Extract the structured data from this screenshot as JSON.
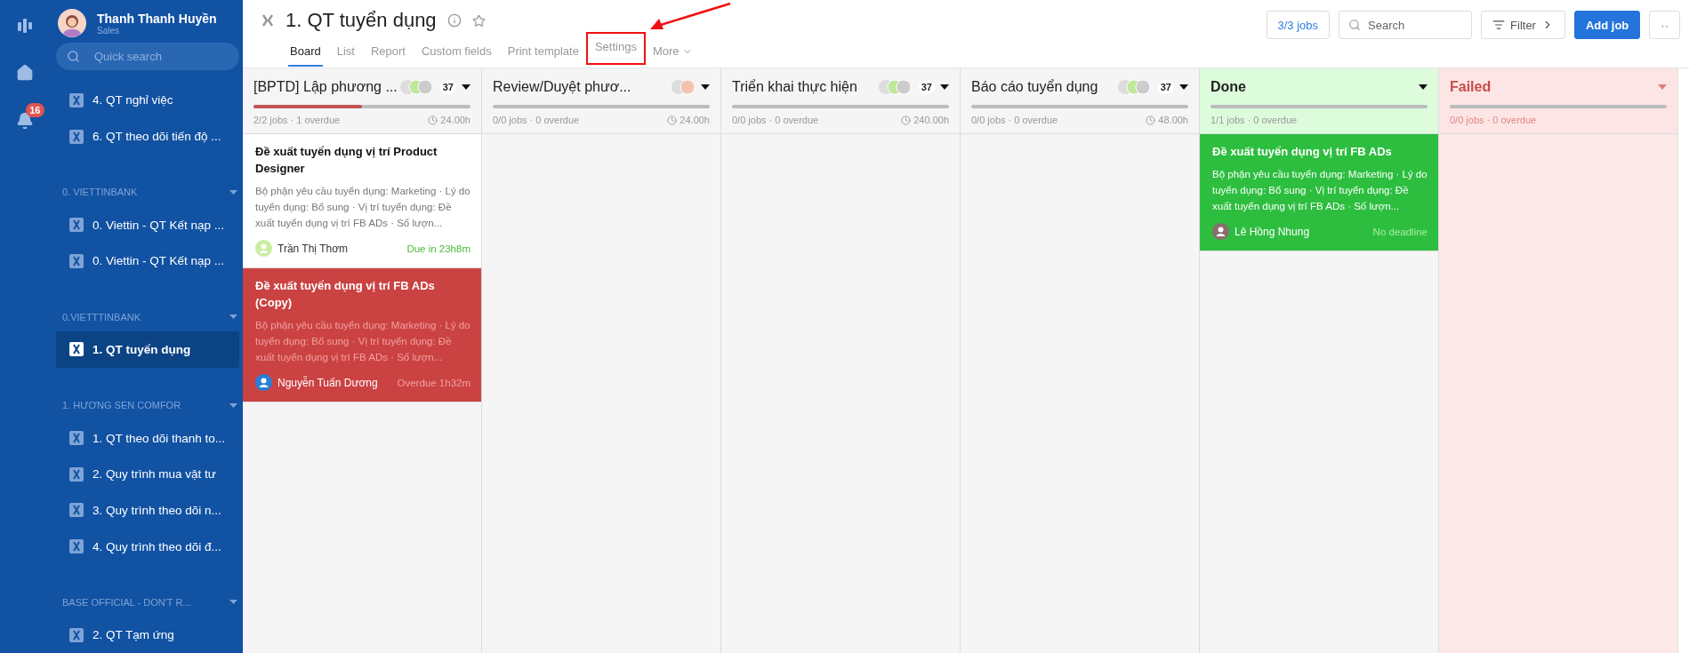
{
  "user": {
    "name": "Thanh Thanh Huyền",
    "role": "Sales"
  },
  "rail": {
    "notification_count": "16"
  },
  "search": {
    "placeholder": "Quick search"
  },
  "sidebar": [
    {
      "kind": "item",
      "label": "4. QT nghỉ việc",
      "selected": false
    },
    {
      "kind": "item",
      "label": "6. QT theo dõi tiến độ ...",
      "selected": false
    },
    {
      "kind": "group",
      "label": "0. VIETTINBANK"
    },
    {
      "kind": "item",
      "label": "0. Viettin - QT Kết nạp ...",
      "selected": false
    },
    {
      "kind": "item",
      "label": "0. Viettin - QT Kết nạp ...",
      "selected": false
    },
    {
      "kind": "group",
      "label": "0.VIETTTINBANK"
    },
    {
      "kind": "item",
      "label": "1. QT tuyển dụng",
      "selected": true
    },
    {
      "kind": "group",
      "label": "1. HƯƠNG SEN COMFOR"
    },
    {
      "kind": "item",
      "label": "1. QT theo dõi thanh to...",
      "selected": false
    },
    {
      "kind": "item",
      "label": "2. Quy trình mua vật tư",
      "selected": false
    },
    {
      "kind": "item",
      "label": "3. Quy trình theo dõi n...",
      "selected": false
    },
    {
      "kind": "item",
      "label": "4. Quy trình theo dõi đ...",
      "selected": false
    },
    {
      "kind": "group",
      "label": "BASE OFFICIAL - DON'T R..."
    },
    {
      "kind": "item",
      "label": "2. QT Tạm ứng",
      "selected": false
    }
  ],
  "page": {
    "title": "1. QT tuyển dụng"
  },
  "tabs": [
    {
      "label": "Board",
      "selected": true,
      "annotated": false
    },
    {
      "label": "List",
      "selected": false,
      "annotated": false
    },
    {
      "label": "Report",
      "selected": false,
      "annotated": false
    },
    {
      "label": "Custom fields",
      "selected": false,
      "annotated": false
    },
    {
      "label": "Print template",
      "selected": false,
      "annotated": false
    },
    {
      "label": "Settings",
      "selected": false,
      "annotated": true
    },
    {
      "label": "More",
      "selected": false,
      "annotated": false
    }
  ],
  "toolbar": {
    "jobs": "3/3 jobs",
    "search_placeholder": "Search",
    "filter": "Filter",
    "add": "Add job",
    "more": "··"
  },
  "columns": [
    {
      "kind": "normal",
      "title": "[BPTD] Lập phương ...",
      "members": true,
      "member_count": "37",
      "level": 0.5,
      "stats": "2/2 jobs · 1 overdue",
      "hours": "24.00h",
      "cards": [
        {
          "kind": "normal",
          "title": "Đề xuất tuyển dụng vị trí Product Designer",
          "description": "Bộ phận yêu cầu tuyển dụng: Marketing · Lý do tuyển dụng: Bổ sung · Vị trí tuyển dụng: Đề xuất tuyển dụng vị trí FB ADs · Số lượn...",
          "assignee": "Trần Thị Thơm",
          "due": "Due in 23h8m"
        },
        {
          "kind": "overdue",
          "title": "Đề xuất tuyển dụng vị trí FB ADs (Copy)",
          "description": "Bộ phận yêu cầu tuyển dụng: Marketing · Lý do tuyển dụng: Bổ sung · Vị trí tuyển dụng: Đề xuất tuyển dụng vị trí FB ADs · Số lượn...",
          "assignee": "Nguyễn Tuấn Dương",
          "due": "Overdue 1h32m"
        }
      ]
    },
    {
      "kind": "normal",
      "title": "Review/Duyệt phươ...",
      "members": true,
      "stats": "0/0 jobs · 0 overdue",
      "hours": "24.00h"
    },
    {
      "kind": "normal",
      "title": "Triển khai thực hiện",
      "members": true,
      "member_count": "37",
      "stats": "0/0 jobs · 0 overdue",
      "hours": "240.00h"
    },
    {
      "kind": "normal",
      "title": "Báo cáo tuyển dụng",
      "members": true,
      "member_count": "37",
      "stats": "0/0 jobs · 0 overdue",
      "hours": "48.00h"
    },
    {
      "kind": "done",
      "title": "Done",
      "members": false,
      "stats": "1/1 jobs · 0 overdue",
      "cards": [
        {
          "kind": "done",
          "title": "Đề xuất tuyển dụng vị trí FB ADs",
          "description": "Bộ phận yêu cầu tuyển dụng: Marketing · Lý do tuyển dụng: Bổ sung · Vị trí tuyển dụng: Đề xuất tuyển dụng vị trí FB ADs · Số lượn...",
          "assignee": "Lê Hồng Nhung",
          "due": "No deadline"
        }
      ]
    },
    {
      "kind": "failed",
      "title": "Failed",
      "members": false,
      "stats": "0/0 jobs · 0 overdue"
    }
  ]
}
